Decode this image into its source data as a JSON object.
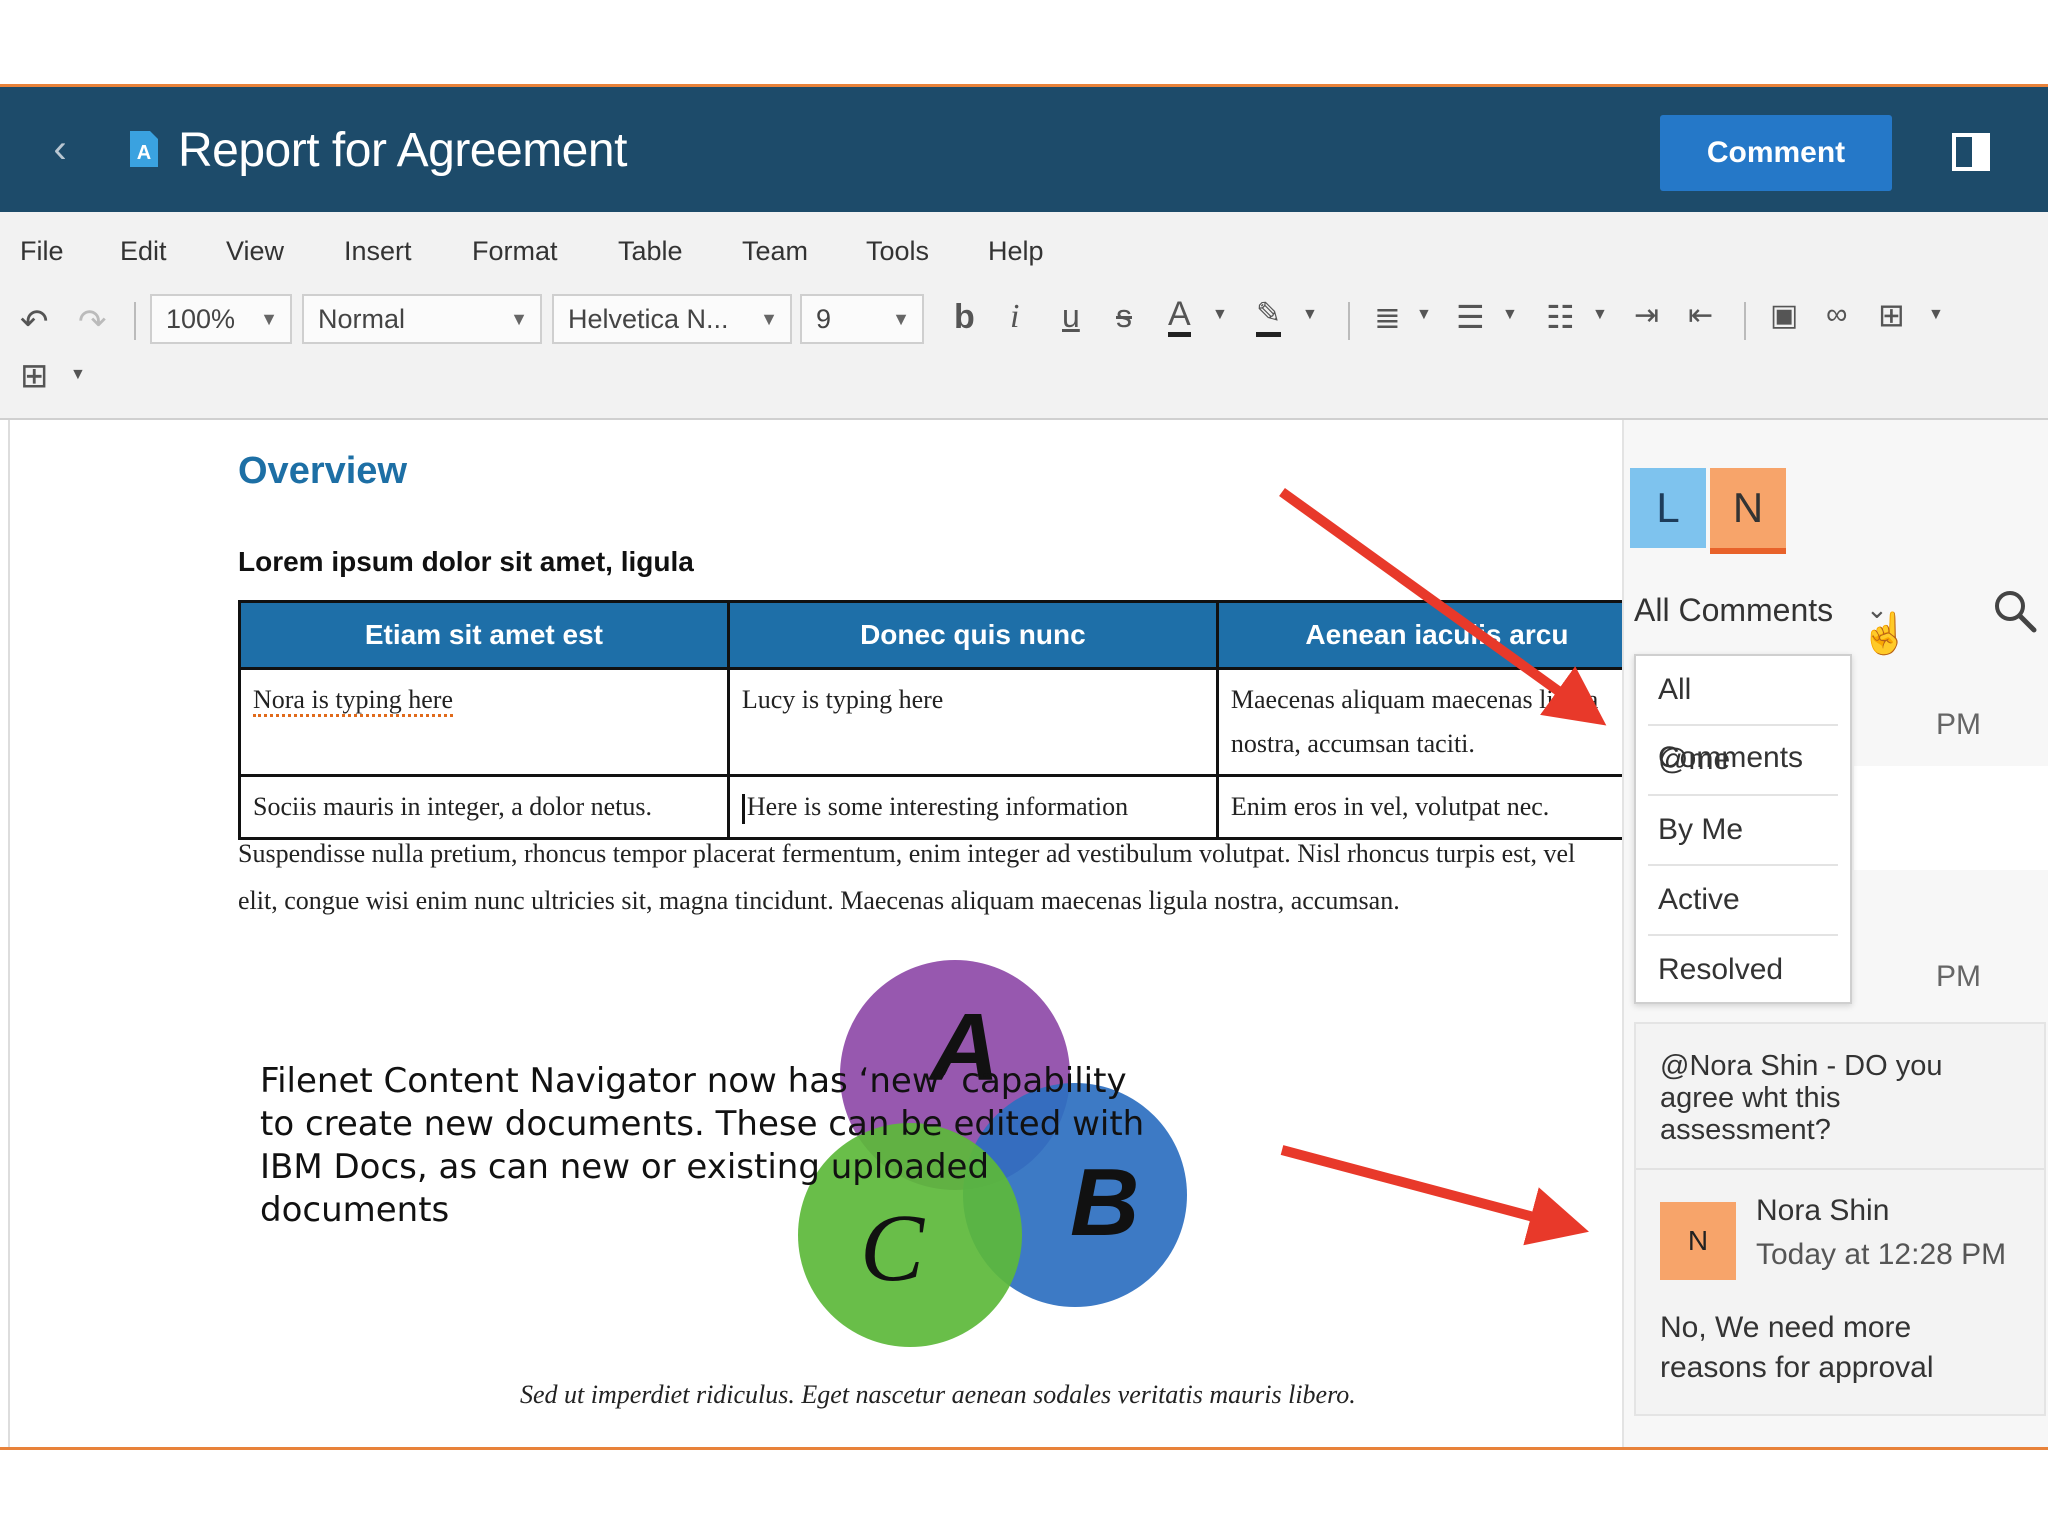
{
  "app": {
    "title": "Report for Agreement",
    "comment_button": "Comment",
    "back_icon": "chevron-left-icon",
    "doc_icon": "document-icon",
    "panel_icon": "sidebar-toggle-icon"
  },
  "menu": [
    "File",
    "Edit",
    "View",
    "Insert",
    "Format",
    "Table",
    "Team",
    "Tools",
    "Help"
  ],
  "toolbar": {
    "zoom": "100%",
    "style": "Normal",
    "font": "Helvetica N...",
    "size": "9",
    "bold": "b",
    "italic": "i",
    "underline": "u",
    "strike": "s",
    "font_color": "A"
  },
  "document": {
    "heading": "Overview",
    "subheading": "Lorem ipsum dolor sit amet, ligula",
    "table": {
      "headers": [
        "Etiam sit amet est",
        "Donec quis nunc",
        "Aenean iaculis arcu"
      ],
      "rows": [
        [
          "Nora is typing here",
          "Lucy is typing here",
          "Maecenas aliquam maecenas ligula nostra, accumsan taciti."
        ],
        [
          "Sociis mauris in integer, a dolor netus.",
          "Here is some interesting information",
          "Enim eros in vel, volutpat nec."
        ]
      ]
    },
    "paragraph_line1": "Suspendisse nulla pretium, rhoncus tempor placerat fermentum, enim integer ad vestibulum volutpat. Nisl rhoncus turpis est, vel",
    "paragraph_line2": "elit, congue wisi enim nunc ultricies sit, magna tincidunt. Maecenas aliquam maecenas ligula nostra, accumsan.",
    "venn": {
      "a": "A",
      "b": "B",
      "c": "C",
      "colors": {
        "a": "#8e4aa8",
        "b": "#2c6fc0",
        "c": "#5cb83a"
      }
    },
    "caption": "Sed ut imperdiet ridiculus. Eget nascetur aenean sodales veritatis mauris libero."
  },
  "note": "Filenet Content Navigator now has ‘new’ capability to create new documents. These can be edited with IBM Docs, as can new or existing uploaded documents",
  "sidebar": {
    "avatars": [
      {
        "letter": "L",
        "color": "#7ec3ee"
      },
      {
        "letter": "N",
        "color": "#f7a46a"
      }
    ],
    "filter_label": "All Comments",
    "dropdown": [
      "All Comments",
      "@me",
      "By Me",
      "Active",
      "Resolved"
    ],
    "pm_1": "PM",
    "pm_2": "PM",
    "comment": {
      "question": "@Nora Shin - DO you agree wht this assessment?",
      "avatar_letter": "N",
      "author": "Nora Shin",
      "time": "Today at 12:28 PM",
      "reply": "No, We need more reasons for approval"
    }
  }
}
